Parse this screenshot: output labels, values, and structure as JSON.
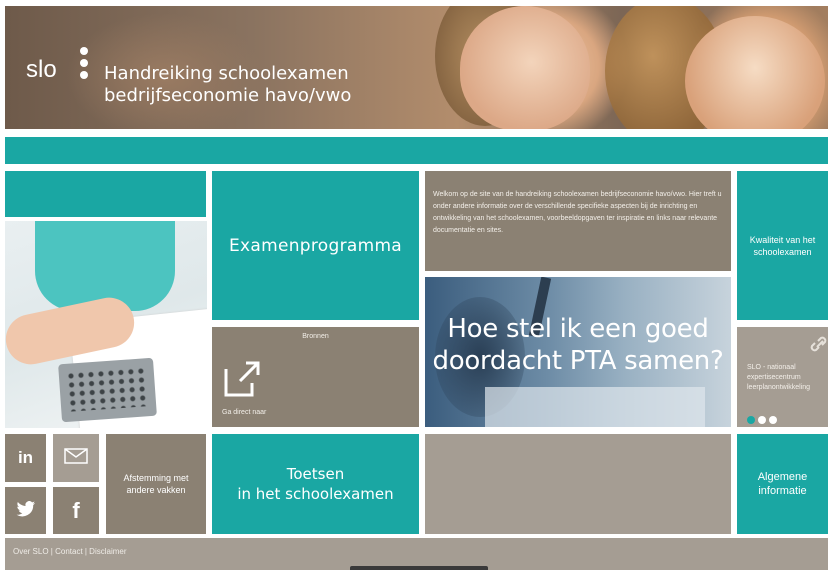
{
  "banner": {
    "logo": "slo",
    "title_line1": "Handreiking schoolexamen",
    "title_line2": "bedrijfseconomie havo/vwo"
  },
  "tiles": {
    "examenprogramma": "Examenprogramma",
    "welkom": "Welkom op de site van de handreiking schoolexamen bedrijfseconomie havo/vwo. Hier treft u onder andere informatie over de verschillende specifieke aspecten bij de inrichting en ontwikkeling van het schoolexamen, voorbeeldopgaven ter inspiratie en links naar relevante documentatie en sites.",
    "kwaliteit": "Kwaliteit van het schoolexamen",
    "bronnen_label": "Bronnen",
    "bronnen_link": "Ga direct naar",
    "pta": "Hoe stel ik een goed doordacht PTA samen?",
    "slo_line1": "SLO - nationaal",
    "slo_line2": "expertisecentrum",
    "slo_line3": "leerplanontwikkeling",
    "afstemming": "Afstemming met andere vakken",
    "toetsen_line1": "Toetsen",
    "toetsen_line2": "in het schoolexamen",
    "algemene_line1": "Algemene",
    "algemene_line2": "informatie"
  },
  "social": {
    "linkedin": "in",
    "twitter": "🐦",
    "facebook": "f"
  },
  "footer": {
    "links": "Over SLO | Contact | Disclaimer"
  },
  "colors": {
    "teal": "#1aa7a3",
    "taupe": "#8b8173",
    "grey": "#a59d93"
  },
  "icons": [
    "cursor-hand-icon",
    "external-link-icon",
    "mail-icon",
    "link-icon",
    "linkedin-icon",
    "twitter-icon",
    "facebook-icon"
  ]
}
